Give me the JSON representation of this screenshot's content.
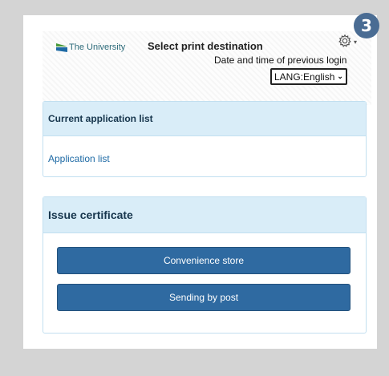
{
  "step_badge": "3",
  "header": {
    "logo_text": "The University",
    "title": "Select print destination",
    "settings_icon": "gear-icon",
    "login_text": "Date and time of previous login",
    "language_select": "LANG:English"
  },
  "application_panel": {
    "title": "Current application list",
    "link": "Application list"
  },
  "certificate_panel": {
    "title": "Issue certificate",
    "buttons": [
      "Convenience store",
      "Sending by post"
    ]
  },
  "colors": {
    "accent": "#2f6aa1",
    "panel_header": "#d9edf8",
    "badge": "#4a6c93"
  }
}
